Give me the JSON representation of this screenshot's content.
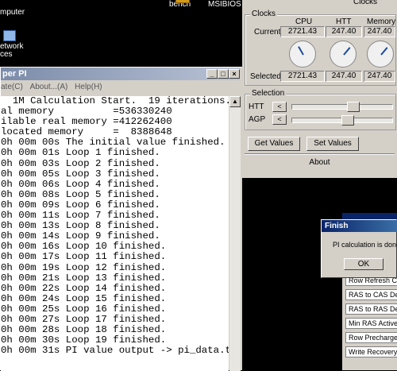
{
  "desktop": {
    "icons": [
      {
        "label": "mputer"
      },
      {
        "label": "bench"
      },
      {
        "label": "MSIBIOS"
      },
      {
        "label": "etwork\nces"
      }
    ]
  },
  "superpi": {
    "title": "per PI",
    "menu": [
      "ate(C)",
      "About...(A)",
      "Help(H)"
    ],
    "lines": [
      "  1M Calculation Start.  19 iterations.",
      "al memory          =536330240",
      "ilable real memory =412262400",
      "located memory     =  8388648",
      "0h 00m 00s The initial value finished.",
      "0h 00m 01s Loop 1 finished.",
      "0h 00m 03s Loop 2 finished.",
      "0h 00m 05s Loop 3 finished.",
      "0h 00m 06s Loop 4 finished.",
      "0h 00m 08s Loop 5 finished.",
      "0h 00m 09s Loop 6 finished.",
      "0h 00m 11s Loop 7 finished.",
      "0h 00m 13s Loop 8 finished.",
      "0h 00m 14s Loop 9 finished.",
      "0h 00m 16s Loop 10 finished.",
      "0h 00m 17s Loop 11 finished.",
      "0h 00m 19s Loop 12 finished.",
      "0h 00m 21s Loop 13 finished.",
      "0h 00m 22s Loop 14 finished.",
      "0h 00m 24s Loop 15 finished.",
      "0h 00m 25s Loop 16 finished.",
      "0h 00m 27s Loop 17 finished.",
      "0h 00m 28s Loop 18 finished.",
      "0h 00m 30s Loop 19 finished.",
      "0h 00m 31s PI value output -> pi_data.t"
    ]
  },
  "clocks": {
    "top_label": "Clocks",
    "group_title": "Clocks",
    "columns": [
      "CPU",
      "HTT",
      "Memory"
    ],
    "current_label": "Current",
    "current_values": [
      "2721.43",
      "247.40",
      "247.40"
    ],
    "selected_label": "Selected",
    "selected_values": [
      "2721.43",
      "247.40",
      "247.40"
    ],
    "selection_title": "Selection",
    "htt_label": "HTT",
    "agp_label": "AGP",
    "htt_level": 0.62,
    "agp_level": 0.55,
    "get_values": "Get Values",
    "set_values": "Set Values",
    "about": "About"
  },
  "timings": {
    "rows": [
      "Row Refresh Cyc",
      "RAS to CAS Dela",
      "RAS to RAS Dela",
      "Min RAS Active T",
      "Row Precharge T",
      "Write Recovery T"
    ]
  },
  "finish": {
    "title": "Finish",
    "message": "PI calculation is done!",
    "ok": "OK"
  }
}
